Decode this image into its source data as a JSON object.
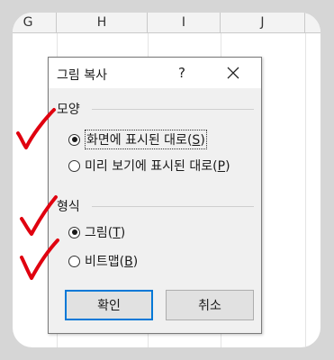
{
  "spreadsheet": {
    "columns": [
      "G",
      "H",
      "I",
      "J"
    ]
  },
  "dialog": {
    "title": "그림 복사",
    "help_label": "?",
    "appearance_group": {
      "label": "모양",
      "options": [
        {
          "text": "화면에 표시된 대로",
          "hotkey": "S",
          "checked": true
        },
        {
          "text": "미리 보기에 표시된 대로",
          "hotkey": "P",
          "checked": false
        }
      ]
    },
    "format_group": {
      "label": "형식",
      "options": [
        {
          "text": "그림",
          "hotkey": "T",
          "checked": true
        },
        {
          "text": "비트맵",
          "hotkey": "B",
          "checked": false
        }
      ]
    },
    "ok_label": "확인",
    "cancel_label": "취소"
  },
  "annotation_color": "#e0000f"
}
